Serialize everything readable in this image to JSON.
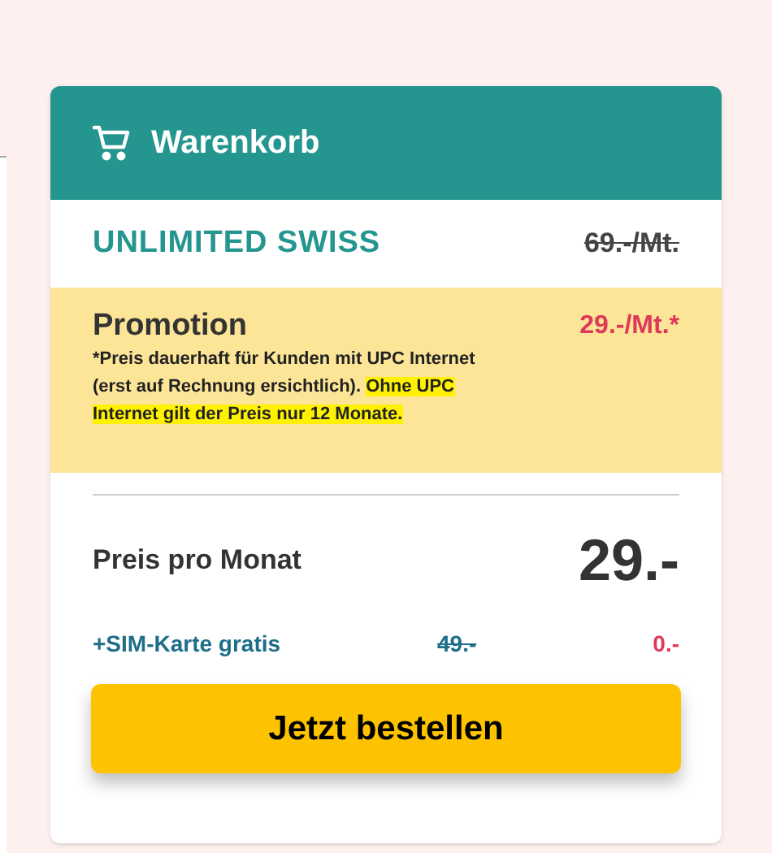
{
  "cart": {
    "title": "Warenkorb"
  },
  "product": {
    "name": "UNLIMITED SWISS",
    "old_price": "69.-/Mt."
  },
  "promotion": {
    "title": "Promotion",
    "price": "29.-/Mt.*",
    "note": [
      {
        "text": "*Preis dauerhaft für Kunden mit UPC Internet (erst auf Rechnung ersichtlich). ",
        "highlighted": false
      },
      {
        "text": "Ohne UPC Internet gilt der Preis nur 12 Monate.",
        "highlighted": true
      }
    ]
  },
  "monthly": {
    "label": "Preis pro Monat",
    "price": "29.-"
  },
  "sim": {
    "label": "+SIM-Karte gratis",
    "old_price": "49.-",
    "price": "0.-"
  },
  "order_button": {
    "label": "Jetzt bestellen"
  }
}
